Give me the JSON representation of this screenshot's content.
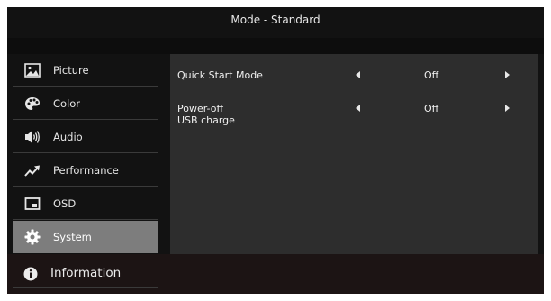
{
  "header": {
    "title": "Mode - Standard"
  },
  "sidebar": {
    "items": [
      {
        "label": "Picture",
        "icon": "picture-icon"
      },
      {
        "label": "Color",
        "icon": "palette-icon"
      },
      {
        "label": "Audio",
        "icon": "speaker-icon"
      },
      {
        "label": "Performance",
        "icon": "trend-arrow-icon"
      },
      {
        "label": "OSD",
        "icon": "osd-window-icon"
      },
      {
        "label": "System",
        "icon": "gear-icon",
        "selected": true
      }
    ]
  },
  "settings": {
    "rows": [
      {
        "label": "Quick Start Mode",
        "value": "Off"
      },
      {
        "label_line1": "Power-off",
        "label_line2": "USB charge",
        "value": "Off"
      }
    ]
  },
  "footer": {
    "label": "Information",
    "icon": "info-icon"
  },
  "colors": {
    "background": "#121212",
    "selected": "#7d7d7d",
    "panel": "#2d2d2d"
  }
}
